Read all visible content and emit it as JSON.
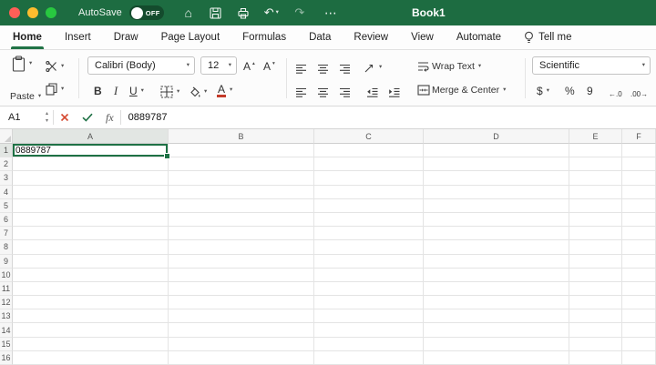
{
  "titlebar": {
    "autosave_label": "AutoSave",
    "autosave_state": "OFF",
    "workbook_title": "Book1"
  },
  "icons": {
    "home": "⌂",
    "undo": "↶",
    "redo": "↷",
    "more": "⋯",
    "bold": "B",
    "italic": "I",
    "underline": "U",
    "font_letter": "A",
    "font_color_letter": "A",
    "fx": "fx",
    "currency": "$",
    "percent": "%",
    "comma_style": "9",
    "increase_decimal": "←.0",
    "decrease_decimal": ".00→"
  },
  "tabs": {
    "items": [
      {
        "label": "Home",
        "active": true
      },
      {
        "label": "Insert",
        "active": false
      },
      {
        "label": "Draw",
        "active": false
      },
      {
        "label": "Page Layout",
        "active": false
      },
      {
        "label": "Formulas",
        "active": false
      },
      {
        "label": "Data",
        "active": false
      },
      {
        "label": "Review",
        "active": false
      },
      {
        "label": "View",
        "active": false
      },
      {
        "label": "Automate",
        "active": false
      }
    ],
    "tell_me": "Tell me"
  },
  "ribbon": {
    "clipboard": {
      "paste_label": "Paste"
    },
    "font": {
      "name": "Calibri (Body)",
      "size": "12"
    },
    "alignment": {
      "wrap_text": "Wrap Text",
      "merge_center": "Merge & Center"
    },
    "number": {
      "format": "Scientific"
    }
  },
  "formula_bar": {
    "cell_ref": "A1",
    "value": "0889787"
  },
  "grid": {
    "columns": [
      "A",
      "B",
      "C",
      "D",
      "E",
      "F"
    ],
    "rows": [
      "1",
      "2",
      "3",
      "4",
      "5",
      "6",
      "7",
      "8",
      "9",
      "10",
      "11",
      "12",
      "13",
      "14",
      "15",
      "16"
    ],
    "selection": "A1",
    "selected_column": "A",
    "selected_row": "1",
    "cells": {
      "A1": "0889787"
    }
  }
}
